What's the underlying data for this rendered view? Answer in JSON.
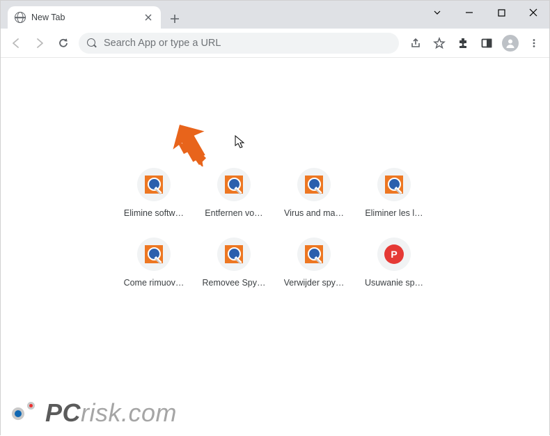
{
  "window": {
    "tab_title": "New Tab"
  },
  "toolbar": {
    "omnibox_placeholder": "Search App or type a URL"
  },
  "shortcuts": [
    {
      "label": "Elimine softw…",
      "icon": "pcr"
    },
    {
      "label": "Entfernen vo…",
      "icon": "pcr"
    },
    {
      "label": "Virus and ma…",
      "icon": "pcr"
    },
    {
      "label": "Eliminer les l…",
      "icon": "pcr"
    },
    {
      "label": "Come rimuov…",
      "icon": "pcr"
    },
    {
      "label": "Removee Spy…",
      "icon": "pcr"
    },
    {
      "label": "Verwijder spy…",
      "icon": "pcr"
    },
    {
      "label": "Usuwanie sp…",
      "icon": "letter",
      "letter": "P",
      "letter_bg": "#e53935"
    }
  ],
  "watermark": {
    "part1": "PC",
    "part2": "risk",
    "part3": ".com"
  }
}
